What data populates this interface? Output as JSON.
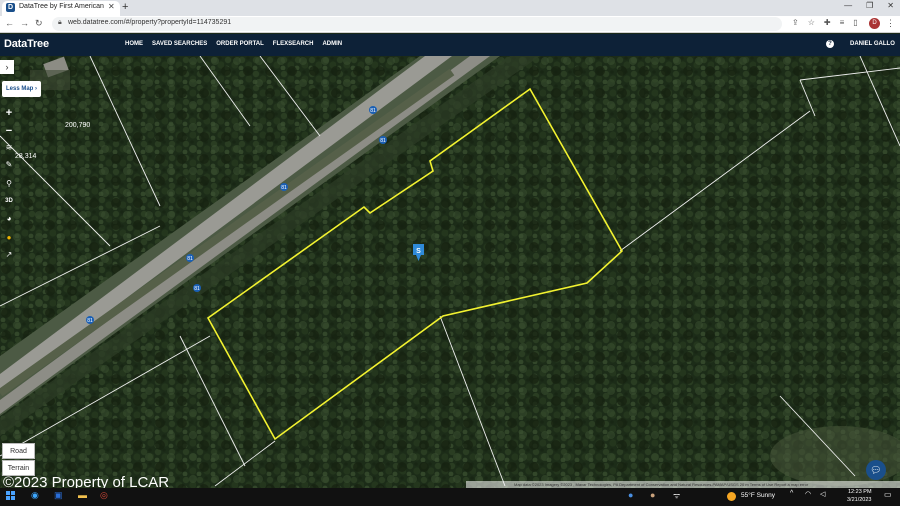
{
  "browser": {
    "tab_title": "DataTree by First American",
    "tab_favicon": "D",
    "url": "web.datatree.com/#/property?propertyId=114735291",
    "profile_initial": "D"
  },
  "app": {
    "logo": "DataTree",
    "nav": [
      "HOME",
      "SAVED SEARCHES",
      "ORDER PORTAL",
      "FLEXSEARCH",
      "ADMIN"
    ],
    "user": "DANIEL GALLO",
    "help_icon": "?"
  },
  "map": {
    "less_map_label": "Less Map",
    "parcel_numbers": [
      "200,790",
      "28,314"
    ],
    "route_shields": [
      "81",
      "81",
      "81",
      "81",
      "81",
      "81"
    ],
    "marker_label": "S",
    "layer_buttons": [
      "Road",
      "Terrain"
    ],
    "watermark": "©2023 Property of LCAR",
    "attribution": "Map data ©2023 Imagery ©2023 , Maxar Technologies, PA Department of Conservation and Natural Resources-PAMAP/USGS   20 m   Terms of Use   Report a map error",
    "tools": [
      "plus-icon",
      "minus-icon",
      "layers-icon",
      "pencil-icon",
      "search-icon",
      "3d-icon",
      "globe-icon",
      "pegman-icon",
      "share-icon"
    ]
  },
  "taskbar": {
    "weather": "55°F  Sunny",
    "time": "12:23 PM",
    "date": "3/21/2023"
  },
  "colors": {
    "parcel_outline": "#f2f230",
    "header_bg": "#0d2137",
    "marker": "#2f8ad8"
  }
}
